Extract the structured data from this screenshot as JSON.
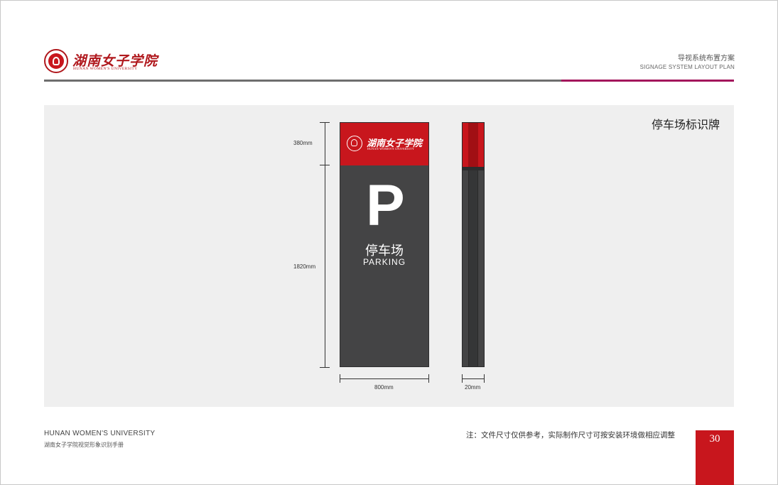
{
  "header": {
    "logo_cn": "湖南女子学院",
    "logo_en": "HUNAN WOMEN'S UNIVERSITY",
    "title_cn": "导视系统布置方案",
    "title_en": "SIGNAGE SYSTEM LAYOUT PLAN"
  },
  "panel": {
    "title": "停车场标识牌",
    "dimensions": {
      "head_height": "380mm",
      "body_height": "1820mm",
      "width": "800mm",
      "depth": "20mm"
    },
    "sign": {
      "logo_cn": "湖南女子学院",
      "logo_en": "HUNAN WOMEN'S UNIVERSITY",
      "symbol": "P",
      "label_cn": "停车场",
      "label_en": "PARKING"
    }
  },
  "footer": {
    "university_en": "HUNAN WOMEN'S  UNIVERSITY",
    "manual_cn": "湖南女子学院视觉形象识别手册",
    "note": "注：文件尺寸仅供参考，实际制作尺寸可按安装环境做相应调整",
    "page_number": "30"
  },
  "colors": {
    "brand_red": "#c8161d",
    "sign_gray": "#444445",
    "accent_magenta": "#a3155c",
    "panel_bg": "#efefef"
  }
}
